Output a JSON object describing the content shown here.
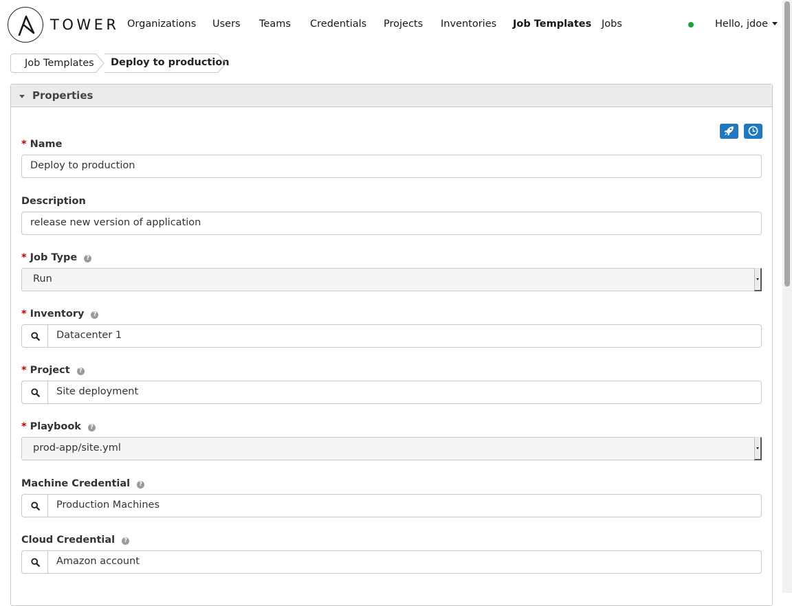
{
  "brand": {
    "logo_text": "TOWER"
  },
  "nav": {
    "items": [
      {
        "label": "Organizations"
      },
      {
        "label": "Users"
      },
      {
        "label": "Teams"
      },
      {
        "label": "Credentials"
      },
      {
        "label": "Projects"
      },
      {
        "label": "Inventories"
      },
      {
        "label": "Job Templates",
        "active": true
      },
      {
        "label": "Jobs"
      }
    ],
    "user_greeting": "Hello, jdoe",
    "status_color": "#16a72e"
  },
  "breadcrumb": {
    "parent": "Job Templates",
    "current": "Deploy to production"
  },
  "panel": {
    "title": "Properties",
    "actions": [
      {
        "icon": "rocket-icon",
        "purpose": "launch"
      },
      {
        "icon": "clock-icon",
        "purpose": "schedule"
      }
    ]
  },
  "form": {
    "required_marker": "*",
    "help_glyph": "?",
    "name": {
      "label": "Name",
      "value": "Deploy to production"
    },
    "description": {
      "label": "Description",
      "value": "release new version of application"
    },
    "job_type": {
      "label": "Job Type",
      "value": "Run"
    },
    "inventory": {
      "label": "Inventory",
      "value": "Datacenter 1"
    },
    "project": {
      "label": "Project",
      "value": "Site deployment"
    },
    "playbook": {
      "label": "Playbook",
      "value": "prod-app/site.yml"
    },
    "machine_credential": {
      "label": "Machine Credential",
      "value": "Production Machines"
    },
    "cloud_credential": {
      "label": "Cloud Credential",
      "value": "Amazon account"
    }
  },
  "colors": {
    "accent": "#1f78c1",
    "required": "#c10000",
    "panel_header": "#ebebeb"
  }
}
